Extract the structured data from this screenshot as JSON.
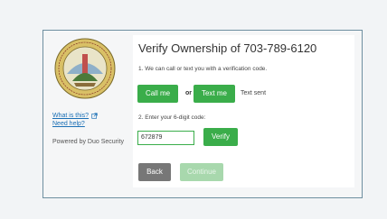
{
  "sidebar": {
    "seal_text": "THE SEAL OF PRINCE WILLIAM COUNTY",
    "what_is_this": "What is this?",
    "need_help": "Need help?",
    "powered_by": "Powered by Duo Security"
  },
  "panel": {
    "title": "Verify Ownership of 703-789-6120",
    "step1": "1. We can call or text you with a verification code.",
    "call_label": "Call me",
    "or_label": "or",
    "text_label": "Text me",
    "status": "Text sent",
    "step2": "2. Enter your 6-digit code:",
    "code_value": "672879",
    "verify_label": "Verify",
    "back_label": "Back",
    "continue_label": "Continue"
  },
  "colors": {
    "accent": "#3aad4a",
    "link": "#1a6fb5",
    "back": "#777777",
    "border": "#6e8fa0"
  }
}
